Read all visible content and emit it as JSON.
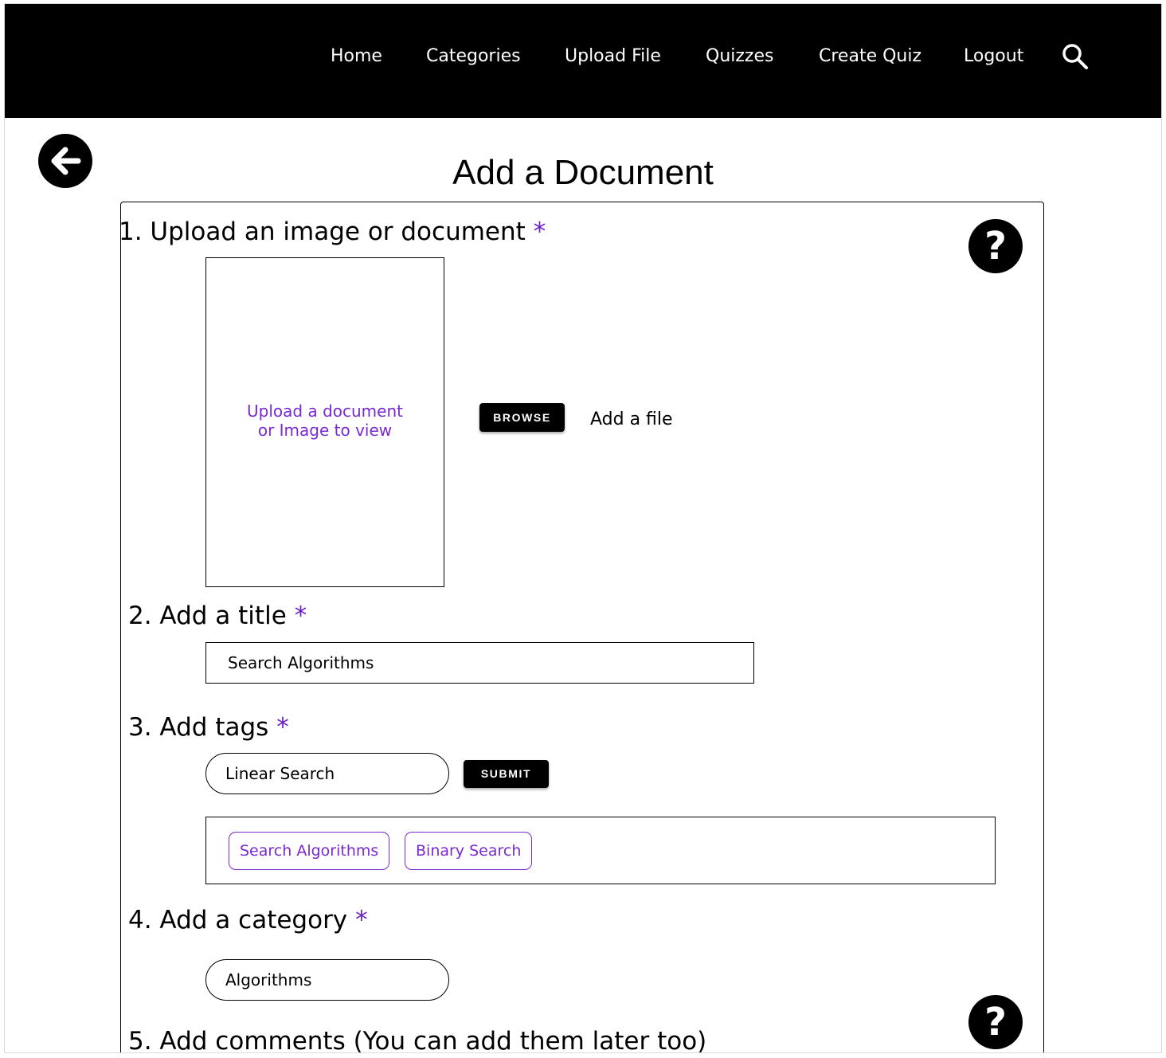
{
  "nav": {
    "items": [
      "Home",
      "Categories",
      "Upload File",
      "Quizzes",
      "Create Quiz",
      "Logout"
    ]
  },
  "page": {
    "title": "Add a Document"
  },
  "steps": {
    "upload": {
      "label": "1. Upload an image or document",
      "required": "*",
      "drop_line1": "Upload a document",
      "drop_line2": "or Image to view",
      "browse_label": "BROWSE",
      "add_file_label": "Add a file"
    },
    "title": {
      "label": "2. Add a title",
      "required": "*",
      "value": "Search Algorithms"
    },
    "tags": {
      "label": "3. Add tags",
      "required": "*",
      "input_value": "Linear Search",
      "submit_label": "SUBMIT",
      "chips": [
        "Search Algorithms",
        "Binary Search"
      ]
    },
    "category": {
      "label": "4. Add a category",
      "required": "*",
      "value": "Algorithms"
    },
    "comments": {
      "label": "5. Add comments (You can add them later too)"
    }
  },
  "help": {
    "glyph": "?"
  },
  "colors": {
    "accent": "#7a2bd0",
    "navbar": "#000000"
  },
  "icons": {
    "search": "search-icon",
    "back": "arrow-left-icon"
  }
}
